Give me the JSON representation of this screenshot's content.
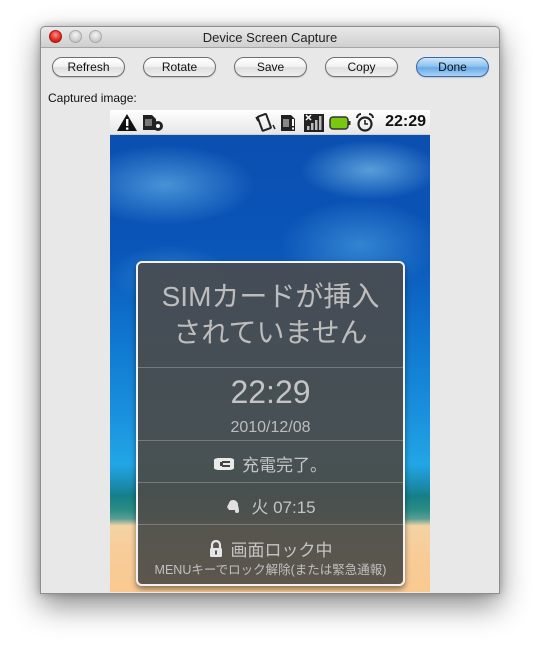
{
  "window": {
    "title": "Device Screen Capture",
    "controls": [
      "close",
      "minimize",
      "zoom"
    ]
  },
  "toolbar": {
    "buttons": [
      {
        "label": "Refresh"
      },
      {
        "label": "Rotate"
      },
      {
        "label": "Save"
      },
      {
        "label": "Copy"
      },
      {
        "label": "Done",
        "primary": true
      }
    ]
  },
  "caption": "Captured image:",
  "device": {
    "statusbar": {
      "left_icons": [
        "warning-icon",
        "sim-settings-icon"
      ],
      "right_icons": [
        "vibrate-icon",
        "no-sim-icon",
        "signal-none-icon",
        "battery-full-icon",
        "alarm-clock-icon"
      ],
      "time": "22:29",
      "battery_color": "#7ac70f"
    },
    "lockscreen": {
      "carrier_message": [
        "SIMカードが挿入",
        "されていません"
      ],
      "time": "22:29",
      "date": "2010/12/08",
      "charging_status": "充電完了。",
      "alarm": "火 07:15",
      "lock_status": "画面ロック中",
      "unlock_hint": "MENUキーでロック解除(または緊急通報)"
    }
  }
}
